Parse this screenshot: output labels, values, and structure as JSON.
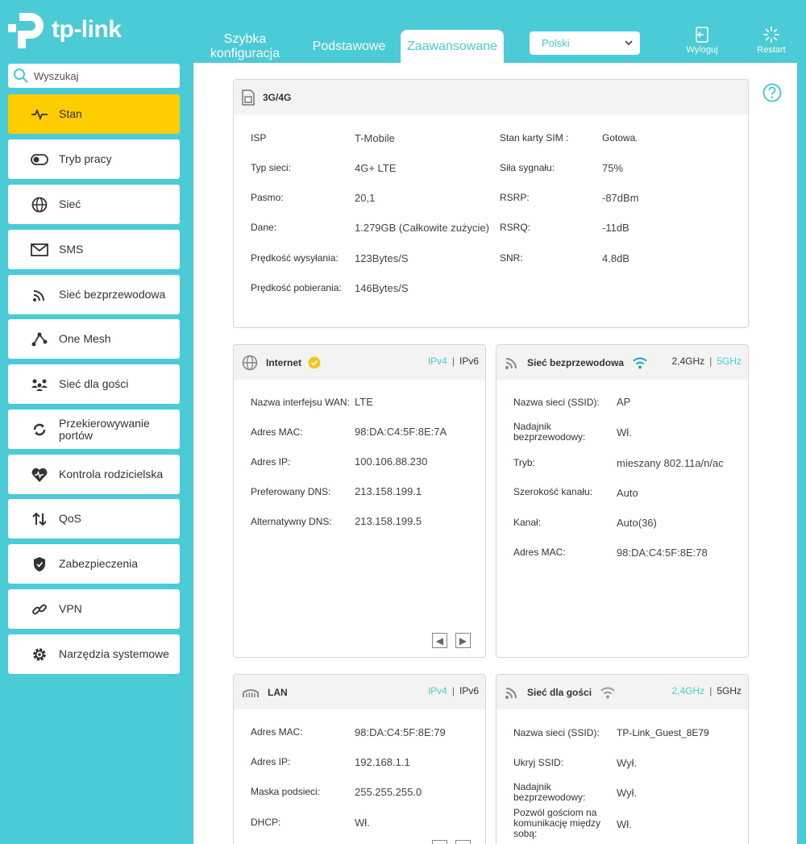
{
  "brand": {
    "logo_text": "tp-link"
  },
  "nav": {
    "tabs": [
      {
        "label_line1": "Szybka",
        "label_line2": "konfiguracja"
      },
      {
        "label": "Podstawowe"
      },
      {
        "label": "Zaawansowane",
        "active": true
      }
    ],
    "language": "Polski",
    "logout_label": "Wyloguj",
    "restart_label": "Restart"
  },
  "search": {
    "placeholder": "Wyszukaj"
  },
  "sidebar": {
    "items": [
      {
        "label": "Stan",
        "icon": "status-pulse-icon",
        "active": true
      },
      {
        "label": "Tryb pracy",
        "icon": "toggle-icon"
      },
      {
        "label": "Sieć",
        "icon": "globe-icon"
      },
      {
        "label": "SMS",
        "icon": "envelope-icon"
      },
      {
        "label": "Sieć bezprzewodowa",
        "icon": "wireless-icon"
      },
      {
        "label": "One Mesh",
        "icon": "mesh-icon"
      },
      {
        "label": "Sieć dla gości",
        "icon": "guests-icon"
      },
      {
        "label_line1": "Przekierowywanie",
        "label_line2": "portów",
        "icon": "forwarding-icon"
      },
      {
        "label": "Kontrola rodzicielska",
        "icon": "heart-icon"
      },
      {
        "label": "QoS",
        "icon": "qos-arrows-icon"
      },
      {
        "label": "Zabezpieczenia",
        "icon": "shield-icon"
      },
      {
        "label": "VPN",
        "icon": "link-icon"
      },
      {
        "label": "Narzędzia systemowe",
        "icon": "gear-icon"
      }
    ]
  },
  "cards": {
    "mobile": {
      "title": "3G/4G",
      "left": [
        {
          "label": "ISP",
          "value": "T-Mobile"
        },
        {
          "label": "Typ sieci:",
          "value": "4G+ LTE"
        },
        {
          "label": "Pasmo:",
          "value": "20,1"
        },
        {
          "label": "Dane:",
          "value": "1.279GB (Całkowite zużycie)"
        },
        {
          "label": "Prędkość wysyłania:",
          "value": "123Bytes/S"
        },
        {
          "label": "Prędkość pobierania:",
          "value": "146Bytes/S"
        }
      ],
      "right": [
        {
          "label": "Stan karty SIM :",
          "value": "Gotowa."
        },
        {
          "label": "Siła sygnału:",
          "value": "75%"
        },
        {
          "label": "RSRP:",
          "value": "-87dBm"
        },
        {
          "label": "RSRQ:",
          "value": "-11dB"
        },
        {
          "label": "SNR:",
          "value": "4.8dB"
        }
      ]
    },
    "internet": {
      "title": "Internet",
      "proto_a": "IPv4",
      "proto_b": "IPv6",
      "rows": [
        {
          "label": "Nazwa interfejsu WAN:",
          "value": "LTE"
        },
        {
          "label": "Adres MAC:",
          "value": "98:DA:C4:5F:8E:7A"
        },
        {
          "label": "Adres IP:",
          "value": "100.106.88.230"
        },
        {
          "label": "Preferowany DNS:",
          "value": "213.158.199.1"
        },
        {
          "label": "Alternatywny DNS:",
          "value": "213.158.199.5"
        }
      ]
    },
    "wireless": {
      "title": "Sieć bezprzewodowa",
      "band_a": "2,4GHz",
      "band_b": "5GHz",
      "rows": [
        {
          "label": "Nazwa sieci (SSID):",
          "value": "AP"
        },
        {
          "label_line1": "Nadajnik",
          "label_line2": "bezprzewodowy:",
          "value": "Wł."
        },
        {
          "label": "Tryb:",
          "value": "mieszany 802.11a/n/ac"
        },
        {
          "label": "Szerokość kanału:",
          "value": "Auto"
        },
        {
          "label": "Kanał:",
          "value": "Auto(36)"
        },
        {
          "label": "Adres MAC:",
          "value": "98:DA:C4:5F:8E:78"
        }
      ]
    },
    "lan": {
      "title": "LAN",
      "proto_a": "IPv4",
      "proto_b": "IPv6",
      "rows": [
        {
          "label": "Adres MAC:",
          "value": "98:DA:C4:5F:8E:79"
        },
        {
          "label": "Adres IP:",
          "value": "192.168.1.1"
        },
        {
          "label": "Maska podsieci:",
          "value": "255.255.255.0"
        },
        {
          "label": "DHCP:",
          "value": "Wł."
        }
      ]
    },
    "guest": {
      "title": "Sieć dla gości",
      "band_a": "2,4GHz",
      "band_b": "5GHz",
      "rows": [
        {
          "label": "Nazwa sieci (SSID):",
          "value": "TP-Link_Guest_8E79"
        },
        {
          "label": "Ukryj SSID:",
          "value": "Wył."
        },
        {
          "label_line1": "Nadajnik",
          "label_line2": "bezprzewodowy:",
          "value": "Wył."
        },
        {
          "label_line1": "Pozwól gościom na",
          "label_line2": "komunikację między",
          "label_line3": "sobą:",
          "value": "Wł."
        }
      ]
    }
  },
  "colors": {
    "accent": "#4ACBD6",
    "active_item": "#FFCC00",
    "status_ok": "#F5C518"
  }
}
